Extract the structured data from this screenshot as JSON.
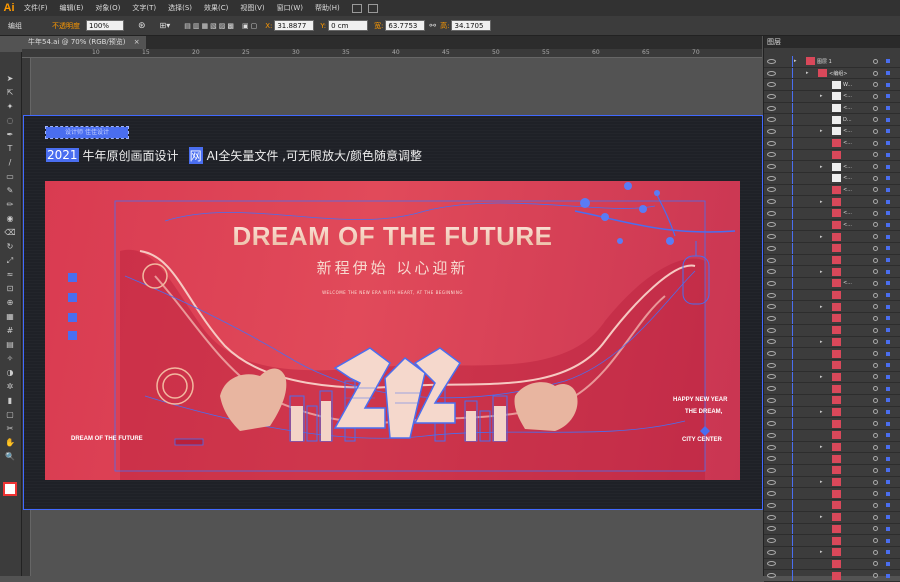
{
  "app": {
    "logo": "Ai"
  },
  "menus": [
    "文件(F)",
    "编辑(E)",
    "对象(O)",
    "文字(T)",
    "选择(S)",
    "效果(C)",
    "视图(V)",
    "窗口(W)",
    "帮助(H)"
  ],
  "control_bar": {
    "group_label": "编组",
    "opacity_label": "不透明度",
    "opacity_value": "100%",
    "x_label": "X:",
    "x_value": "31.8877",
    "y_label": "Y:",
    "y_value": "0 cm",
    "width_label": "宽:",
    "width_value": "63.7753",
    "height_label": "高:",
    "height_value": "34.1705"
  },
  "document_tab": {
    "title": "牛年54.ai @ 70% (RGB/预览)",
    "close": "×"
  },
  "ruler": {
    "ticks": [
      "10",
      "15",
      "20",
      "25",
      "30",
      "35",
      "40",
      "45",
      "50",
      "55",
      "60",
      "65",
      "70"
    ]
  },
  "header_tag": "设计师 佳佳设计",
  "description": {
    "badge1": "2021",
    "text1": "牛年原创画面设计",
    "badge2": "网",
    "text2": "AI全矢量文件 ,可无限放大/颜色随意调整"
  },
  "poster": {
    "title": "DREAM OF THE FUTURE",
    "subtitle": "新程伊始  以心迎新",
    "small": "WELCOME THE NEW ERA WITH HEART, AT THE BEGINNING",
    "year": "2021",
    "left_caption": "DREAM OF THE FUTURE",
    "right_caption1": "HAPPY NEW YEAR",
    "right_caption2": "THE DREAM,",
    "right_caption3": "CITY CENTER"
  },
  "layers_panel": {
    "title": "图层",
    "top_layer": "图层 1",
    "group": "<编组>",
    "rows": [
      {
        "name": "W...",
        "thumb": "white"
      },
      {
        "name": "<...",
        "thumb": "white"
      },
      {
        "name": "<...",
        "thumb": "white"
      },
      {
        "name": "D...",
        "thumb": "white"
      },
      {
        "name": "<...",
        "thumb": "white"
      },
      {
        "name": "<...",
        "thumb": "red"
      },
      {
        "name": "",
        "thumb": "red"
      },
      {
        "name": "<...",
        "thumb": "white"
      },
      {
        "name": "<...",
        "thumb": "white"
      },
      {
        "name": "<...",
        "thumb": "red"
      },
      {
        "name": "",
        "thumb": "red"
      },
      {
        "name": "<...",
        "thumb": "red"
      },
      {
        "name": "<...",
        "thumb": "red"
      },
      {
        "name": "",
        "thumb": "red"
      },
      {
        "name": "",
        "thumb": "red"
      },
      {
        "name": "",
        "thumb": "red"
      },
      {
        "name": "",
        "thumb": "red"
      },
      {
        "name": "<...",
        "thumb": "red"
      },
      {
        "name": "",
        "thumb": "red"
      },
      {
        "name": "",
        "thumb": "red"
      },
      {
        "name": "",
        "thumb": "red"
      },
      {
        "name": "",
        "thumb": "red"
      },
      {
        "name": "",
        "thumb": "red"
      },
      {
        "name": "",
        "thumb": "red"
      },
      {
        "name": "",
        "thumb": "red"
      },
      {
        "name": "",
        "thumb": "red"
      },
      {
        "name": "",
        "thumb": "red"
      },
      {
        "name": "",
        "thumb": "red"
      },
      {
        "name": "",
        "thumb": "red"
      },
      {
        "name": "",
        "thumb": "red"
      },
      {
        "name": "",
        "thumb": "red"
      },
      {
        "name": "",
        "thumb": "red"
      },
      {
        "name": "",
        "thumb": "red"
      },
      {
        "name": "",
        "thumb": "red"
      },
      {
        "name": "",
        "thumb": "red"
      },
      {
        "name": "",
        "thumb": "red"
      },
      {
        "name": "",
        "thumb": "red"
      },
      {
        "name": "",
        "thumb": "red"
      },
      {
        "name": "",
        "thumb": "red"
      },
      {
        "name": "",
        "thumb": "red"
      },
      {
        "name": "",
        "thumb": "red"
      },
      {
        "name": "",
        "thumb": "red"
      },
      {
        "name": "",
        "thumb": "red"
      }
    ]
  },
  "tools": [
    "selection-tool",
    "direct-selection-tool",
    "magic-wand-tool",
    "lasso-tool",
    "pen-tool",
    "type-tool",
    "line-tool",
    "rectangle-tool",
    "paintbrush-tool",
    "pencil-tool",
    "blob-brush-tool",
    "eraser-tool",
    "rotate-tool",
    "scale-tool",
    "warp-tool",
    "free-transform-tool",
    "shape-builder-tool",
    "perspective-grid-tool",
    "mesh-tool",
    "gradient-tool",
    "eyedropper-tool",
    "blend-tool",
    "symbol-sprayer-tool",
    "column-graph-tool",
    "artboard-tool",
    "slice-tool",
    "hand-tool",
    "zoom-tool"
  ],
  "colors": {
    "accent": "#4a6ef0",
    "poster_red": "#d93b51",
    "orange": "#ff9a00"
  }
}
